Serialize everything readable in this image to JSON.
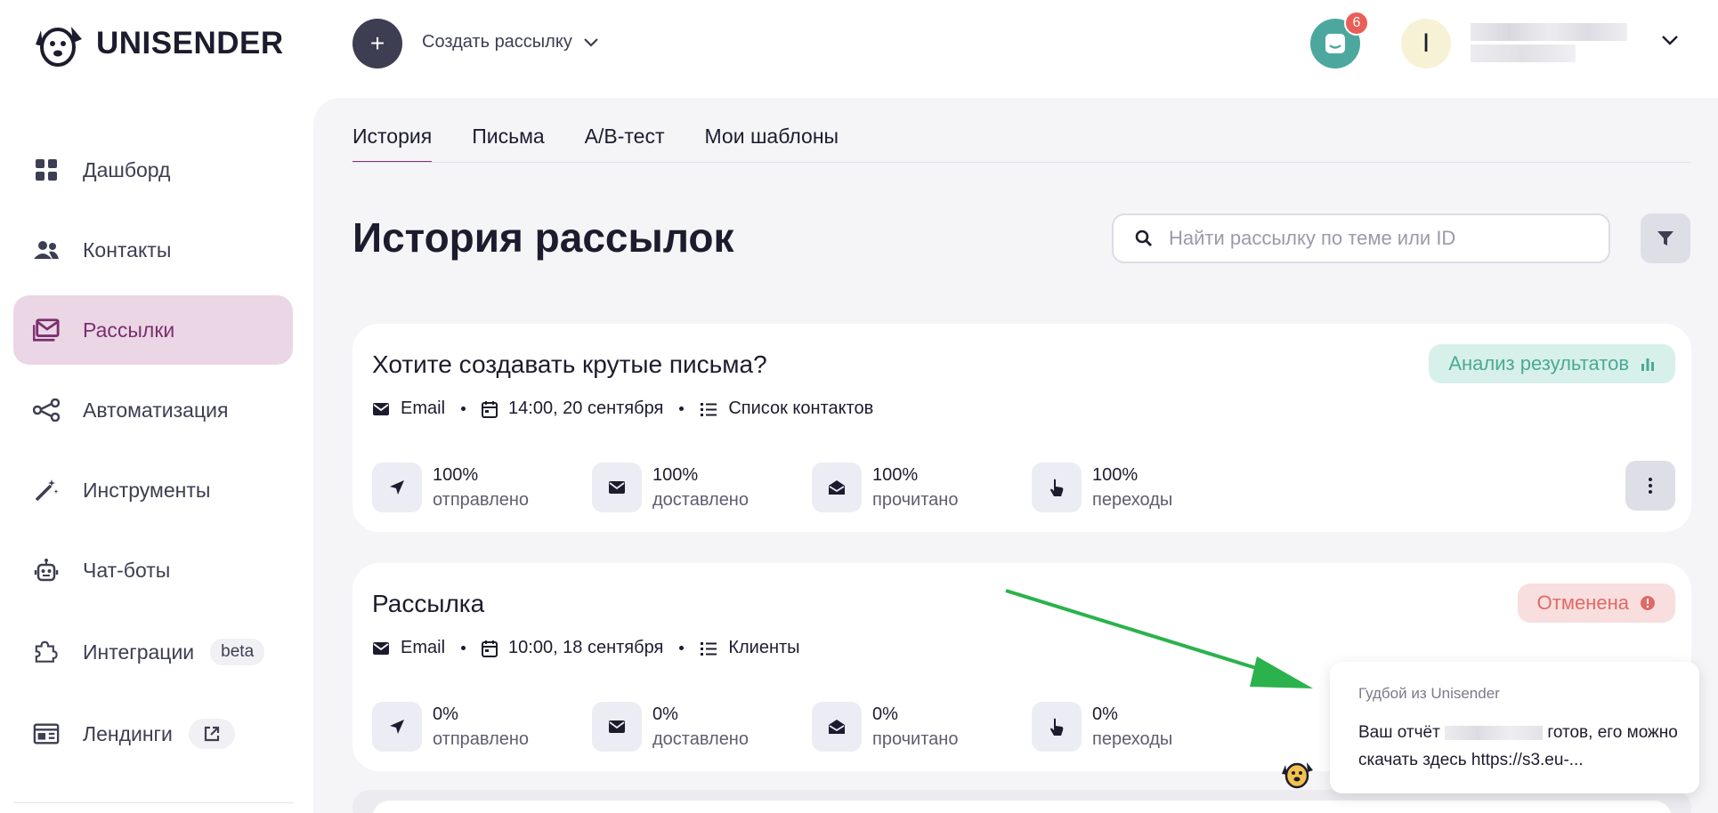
{
  "brand": {
    "name": "UNISENDER"
  },
  "header": {
    "create_label": "Создать рассылку",
    "notifications_count": "6",
    "avatar_initial": "I"
  },
  "sidebar": {
    "items": [
      {
        "label": "Дашборд",
        "icon": "dashboard-grid-icon"
      },
      {
        "label": "Контакты",
        "icon": "contacts-icon"
      },
      {
        "label": "Рассылки",
        "icon": "campaigns-icon",
        "active": true
      },
      {
        "label": "Автоматизация",
        "icon": "automation-icon"
      },
      {
        "label": "Инструменты",
        "icon": "magic-wand-icon"
      },
      {
        "label": "Чат-боты",
        "icon": "robot-icon"
      },
      {
        "label": "Интеграции",
        "icon": "puzzle-icon",
        "badge": "beta"
      },
      {
        "label": "Лендинги",
        "icon": "landing-icon",
        "external": true
      }
    ]
  },
  "tabs": [
    {
      "label": "История",
      "active": true
    },
    {
      "label": "Письма"
    },
    {
      "label": "A/B-тест"
    },
    {
      "label": "Мои шаблоны"
    }
  ],
  "page": {
    "title": "История рассылок",
    "search_placeholder": "Найти рассылку по теме или ID"
  },
  "campaigns": [
    {
      "title": "Хотите создавать крутые письма?",
      "channel": "Email",
      "datetime": "14:00, 20 сентября",
      "list": "Список контактов",
      "status": "Анализ результатов",
      "stats": [
        {
          "value": "100%",
          "label": "отправлено"
        },
        {
          "value": "100%",
          "label": "доставлено"
        },
        {
          "value": "100%",
          "label": "прочитано"
        },
        {
          "value": "100%",
          "label": "переходы"
        }
      ]
    },
    {
      "title": "Рассылка",
      "channel": "Email",
      "datetime": "10:00, 18 сентября",
      "list": "Клиенты",
      "status": "Отменена",
      "stats": [
        {
          "value": "0%",
          "label": "отправлено"
        },
        {
          "value": "0%",
          "label": "доставлено"
        },
        {
          "value": "0%",
          "label": "прочитано"
        },
        {
          "value": "0%",
          "label": "переходы"
        }
      ]
    }
  ],
  "notification": {
    "from": "Гудбой из Unisender",
    "text_before": "Ваш отчёт",
    "text_after": "готов, его можно скачать здесь https://s3.eu-..."
  },
  "colors": {
    "active_nav_bg": "#ead6e4",
    "active_nav_text": "#7b2f6f",
    "success_pill": "#d7f0ea",
    "cancel_pill": "#f8dede",
    "notification_bell": "#4ca89f",
    "arrow": "#2bb24c"
  }
}
